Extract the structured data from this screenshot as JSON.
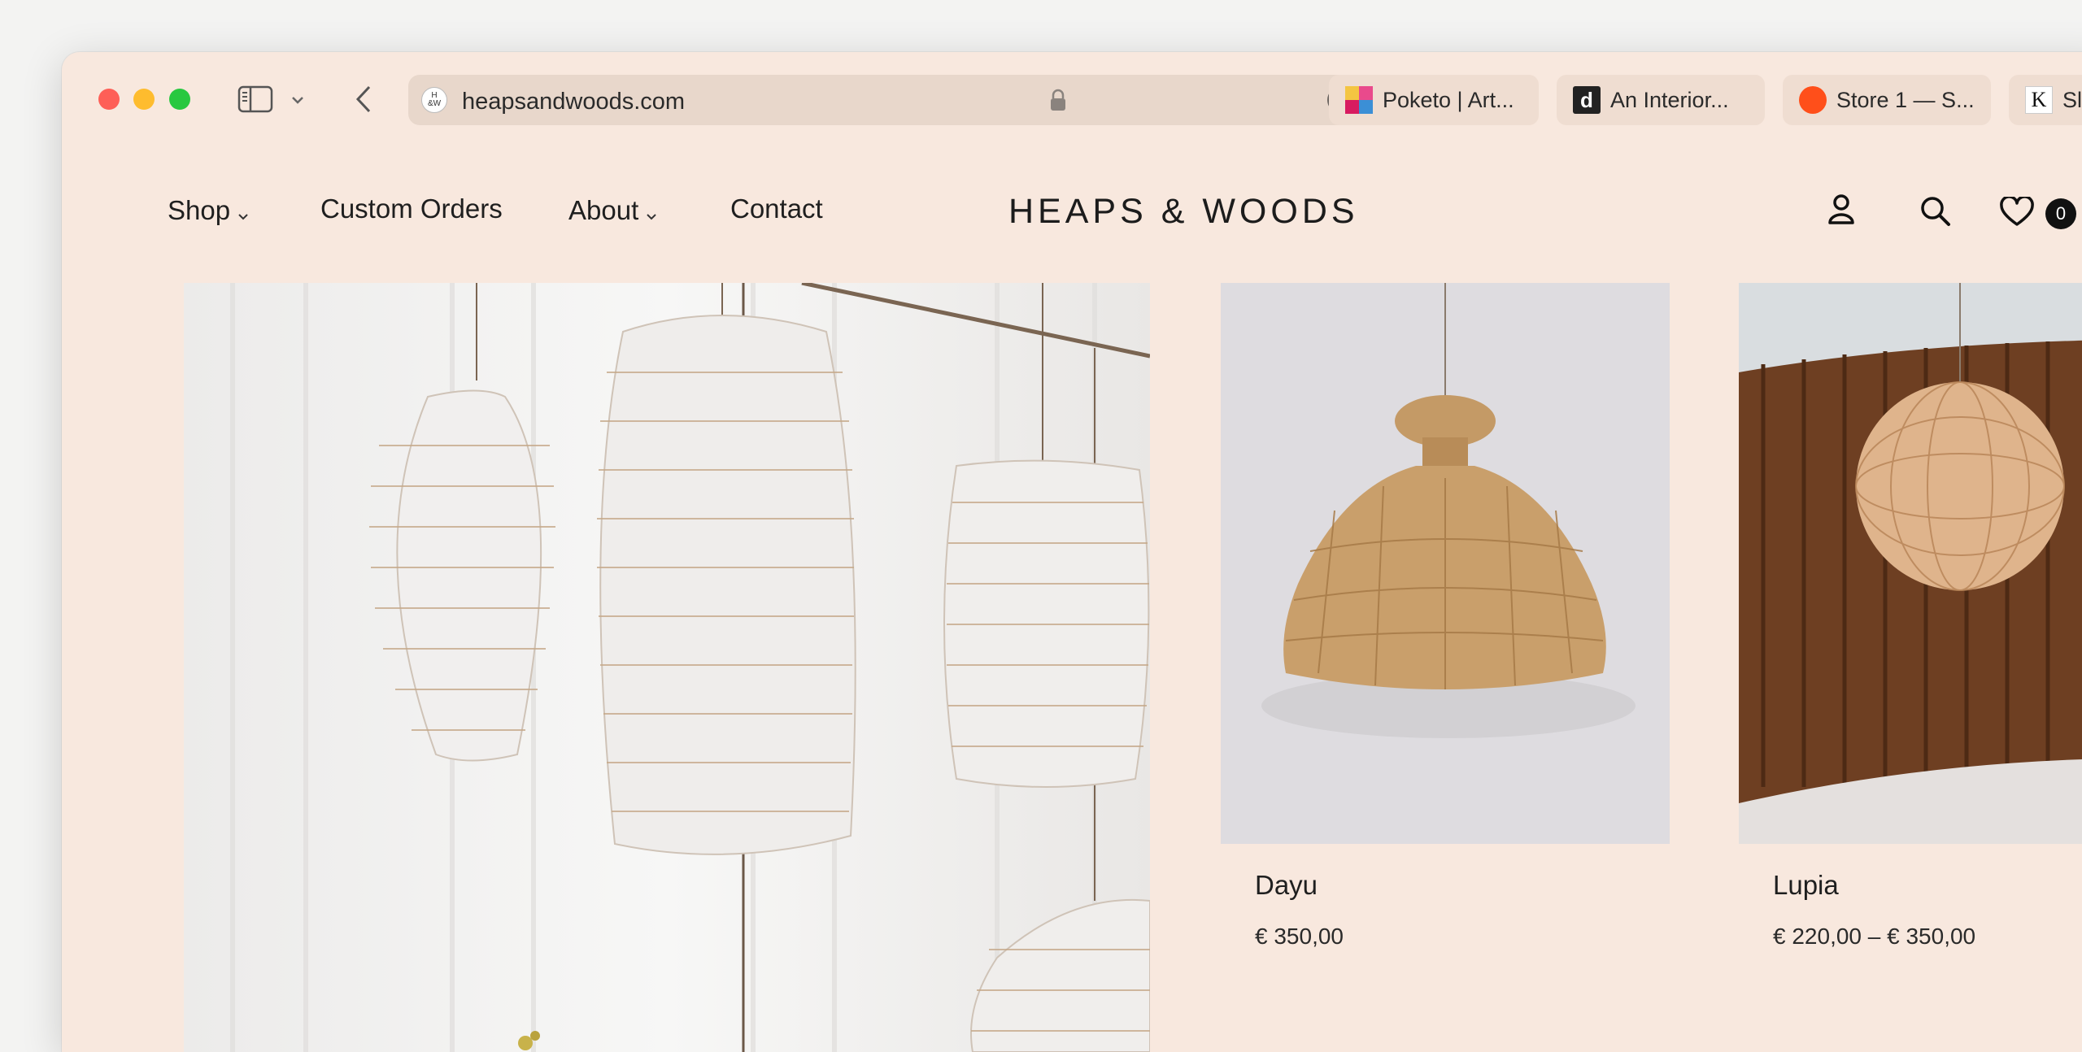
{
  "browser": {
    "address": {
      "url": "heapsandwoods.com",
      "site_icon_text_top": "H",
      "site_icon_text_bottom": "&W"
    },
    "tabs": [
      {
        "label": "Poketo | Art...",
        "icon": "poketo-favicon"
      },
      {
        "label": "An Interior...",
        "icon": "d-favicon"
      },
      {
        "label": "Store 1 — S...",
        "icon": "orange-circle-favicon"
      },
      {
        "label": "Sl",
        "icon": "k-favicon",
        "icon_text": "K"
      }
    ],
    "icon_text": {
      "d_favicon": "d"
    }
  },
  "site": {
    "brand": "HEAPS & WOODS",
    "nav": [
      {
        "label": "Shop",
        "has_dropdown": true
      },
      {
        "label": "Custom Orders",
        "has_dropdown": false
      },
      {
        "label": "About",
        "has_dropdown": true
      },
      {
        "label": "Contact",
        "has_dropdown": false
      }
    ],
    "cart_count": "0"
  },
  "products": [
    {
      "name": "Dayu",
      "price": "€ 350,00"
    },
    {
      "name": "Lupia",
      "price": "€ 220,00 – € 350,00"
    }
  ],
  "colors": {
    "page_bg": "#f8e8de",
    "address_bar": "#e8d7cb",
    "tab_bg": "#efddd1",
    "text": "#1f1f1f"
  }
}
